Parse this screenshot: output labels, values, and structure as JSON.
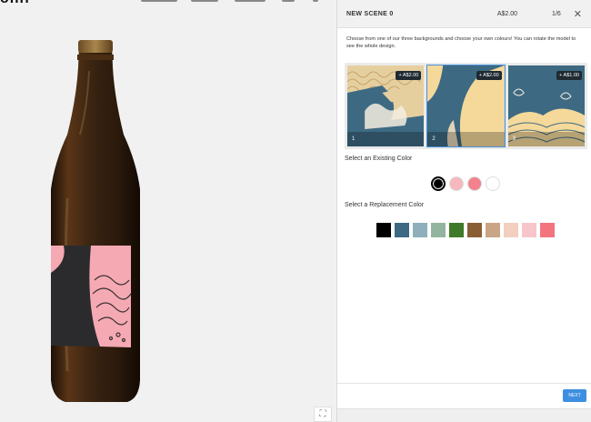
{
  "header": {
    "logo_fragment": "ohif",
    "title": "NEW SCENE 0",
    "price": "A$2.00",
    "step": "1/6",
    "close_icon": "close-icon"
  },
  "panel": {
    "description": "Choose from one of our three backgrounds and choose your own colours! You can rotate the model to see the whole design.",
    "backgrounds": [
      {
        "number": "1",
        "price": "+ A$2.00"
      },
      {
        "number": "2",
        "price": "+ A$2.00"
      },
      {
        "number": "3",
        "price": "+ A$1.00"
      }
    ],
    "existing_title": "Select an Existing Color",
    "existing_colors": [
      "#000000",
      "#f6b8bd",
      "#f4828e",
      "#ffffff"
    ],
    "replacement_title": "Select a Replacement Color",
    "replacement_colors": [
      "#000000",
      "#3d6a82",
      "#8fb0bb",
      "#93b59f",
      "#3f7a2a",
      "#8a5e34",
      "#c9a585",
      "#f2cfbf",
      "#f7c6cb",
      "#f3747f"
    ],
    "next_label": "NEXT"
  },
  "viewer": {
    "fullscreen_icon": "fullscreen-icon",
    "label_colors": {
      "pink": "#f4a9b3",
      "dark": "#2b2b2d",
      "glass": "#3a2412"
    }
  }
}
